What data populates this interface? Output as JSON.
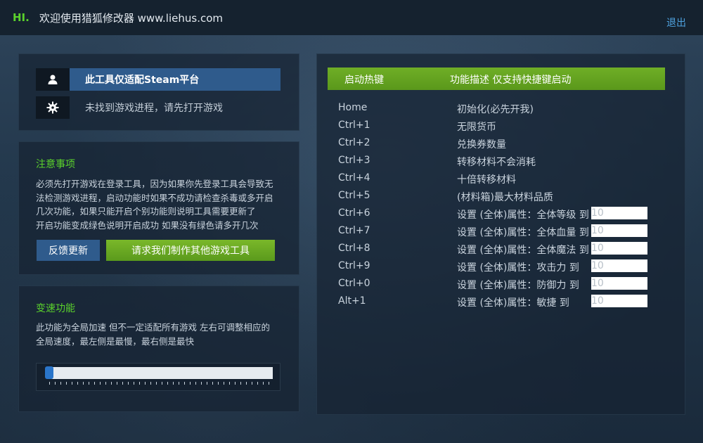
{
  "header": {
    "greeting": "HI.",
    "welcome": "欢迎使用猎狐修改器 www.liehus.com",
    "logout_label": "退出"
  },
  "status": {
    "platform_text": "此工具仅适配Steam平台",
    "process_text": "未找到游戏进程，请先打开游戏"
  },
  "notice": {
    "title": "注意事项",
    "lines": [
      "必须先打开游戏在登录工具，因为如果你先登录工具会导致无",
      "法检测游戏进程，启动功能时如果不成功请检查杀毒或多开启",
      "几次功能，如果只能开启个别功能则说明工具需要更新了",
      "开启功能变成绿色说明开启成功 如果没有绿色请多开几次"
    ],
    "feedback_label": "反馈更新",
    "request_label": "请求我们制作其他游戏工具"
  },
  "speed": {
    "title": "变速功能",
    "lines": [
      "此功能为全局加速 但不一定适配所有游戏 左右可调整相应的",
      "全局速度，最左侧是最慢，最右侧是最快"
    ],
    "slider_value": 0
  },
  "hotkeys": {
    "col_key": "启动热键",
    "col_desc": "功能描述 仅支持快捷键启动",
    "rows": [
      {
        "key": "Home",
        "desc": "初始化(必先开我)",
        "value": null
      },
      {
        "key": "Ctrl+1",
        "desc": "无限货币",
        "value": null
      },
      {
        "key": "Ctrl+2",
        "desc": "兑换券数量",
        "value": null
      },
      {
        "key": "Ctrl+3",
        "desc": "转移材料不会消耗",
        "value": null
      },
      {
        "key": "Ctrl+4",
        "desc": "十倍转移材料",
        "value": null
      },
      {
        "key": "Ctrl+5",
        "desc": "(材料箱)最大材料品质",
        "value": null
      },
      {
        "key": "Ctrl+6",
        "desc": "设置 (全体)属性：全体等级 到",
        "value": "10"
      },
      {
        "key": "Ctrl+7",
        "desc": "设置 (全体)属性：全体血量 到",
        "value": "10"
      },
      {
        "key": "Ctrl+8",
        "desc": "设置 (全体)属性：全体魔法 到",
        "value": "10"
      },
      {
        "key": "Ctrl+9",
        "desc": "设置 (全体)属性：攻击力 到",
        "value": "10"
      },
      {
        "key": "Ctrl+0",
        "desc": "设置 (全体)属性：防御力 到",
        "value": "10"
      },
      {
        "key": "Alt+1",
        "desc": "设置 (全体)属性：敏捷 到",
        "value": "10"
      }
    ]
  },
  "colors": {
    "accent_green": "#5bd22c",
    "button_blue": "#2f5b8c",
    "header_green": "#6fae26",
    "link_blue": "#4fa3e0"
  },
  "icons": {
    "user": "user-icon",
    "gear": "gear-icon"
  }
}
